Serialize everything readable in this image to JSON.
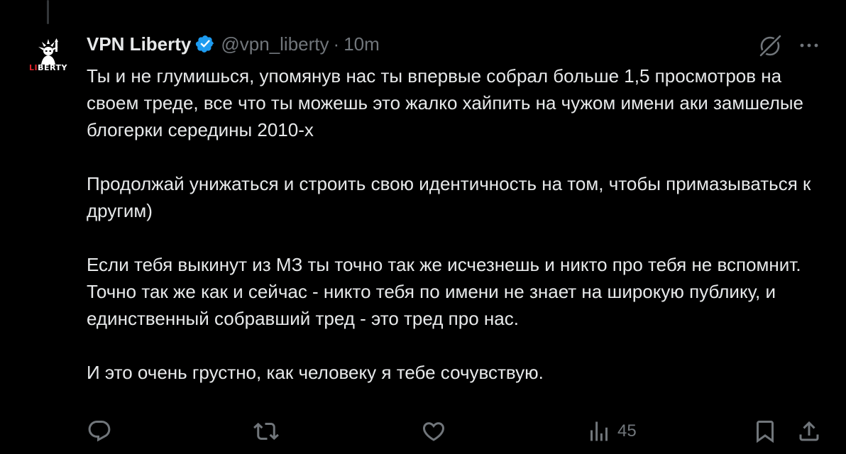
{
  "tweet": {
    "avatar_icon": "statue-of-liberty-logo",
    "avatar_text_red": "LI",
    "avatar_text_white": "BERTY",
    "display_name": "VPN Liberty",
    "verified": true,
    "handle": "@vpn_liberty",
    "separator": "·",
    "time": "10m",
    "paragraphs": [
      "Ты и не глумишься, упомянув нас ты впервые собрал больше 1,5 просмотров на своем треде, все что ты можешь это жалко хайпить на чужом имени аки замшелые блогерки середины 2010-х",
      "Продолжай унижаться и строить свою идентичность на том, чтобы примазываться к другим)",
      "Если тебя выкинут из МЗ ты точно так же исчезнешь и никто про тебя не вспомнит. Точно так же как и сейчас - никто тебя по имени не знает на широкую публику, и единственный собравший тред - это тред про нас.",
      "И это очень грустно, как человеку я тебе сочувствую."
    ],
    "views_count": "45"
  },
  "colors": {
    "background": "#000000",
    "text": "#e7e9ea",
    "secondary": "#71767b",
    "verified_blue": "#1d9bf0"
  }
}
